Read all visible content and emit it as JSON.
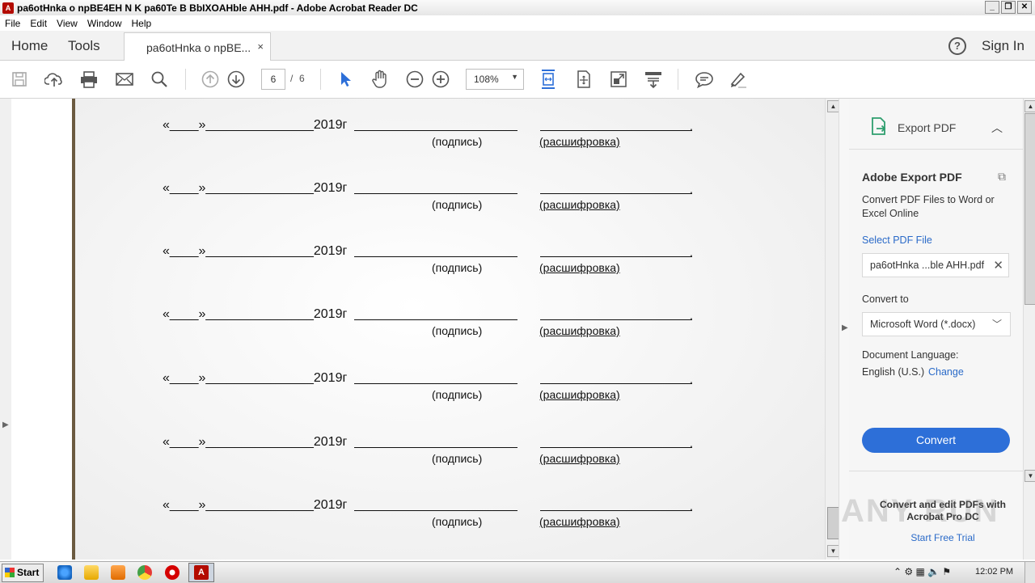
{
  "window": {
    "title": "pa6otHnka o npBE4EH N K pa60Te B BbIXOAHble AHH.pdf - Adobe Acrobat Reader DC",
    "icon_letter": "A",
    "controls": [
      "_",
      "❐",
      "✕"
    ]
  },
  "menu": [
    "File",
    "Edit",
    "View",
    "Window",
    "Help"
  ],
  "tabs": {
    "home": "Home",
    "tools": "Tools",
    "document": "pa6otHnka o npBE...",
    "close": "×",
    "help": "?",
    "sign_in": "Sign In"
  },
  "toolbar": {
    "page_current": "6",
    "page_sep": "/",
    "page_total": "6",
    "zoom": "108%",
    "icons": [
      "save-icon",
      "upload-cloud-icon",
      "print-icon",
      "email-icon",
      "search-icon",
      "page-up-icon",
      "page-down-icon",
      "select-arrow-icon",
      "hand-icon",
      "zoom-out-icon",
      "zoom-in-icon",
      "fit-width-icon",
      "scroll-mode-icon",
      "full-screen-icon",
      "read-mode-icon",
      "comment-icon",
      "highlight-pen-icon"
    ]
  },
  "document": {
    "rows": [
      {
        "date": "«____»_______________2019г",
        "sign": "(подпись)",
        "name": "(расшифровка)",
        "dot": "."
      },
      {
        "date": "«____»_______________2019г",
        "sign": "(подпись)",
        "name": "(расшифровка)",
        "dot": "."
      },
      {
        "date": "«____»_______________2019г",
        "sign": "(подпись)",
        "name": "(расшифровка)",
        "dot": "."
      },
      {
        "date": "«____»_______________2019г",
        "sign": "(подпись)",
        "name": "(расшифровка)",
        "dot": "."
      },
      {
        "date": "«____»_______________2019г",
        "sign": "(подпись)",
        "name": "(расшифровка)",
        "dot": "."
      },
      {
        "date": "«____»_______________2019г",
        "sign": "(подпись)",
        "name": "(расшифровка)",
        "dot": "."
      },
      {
        "date": "«____»_______________2019г",
        "sign": "(подпись)",
        "name": "(расшифровка)",
        "dot": "."
      }
    ]
  },
  "export_panel": {
    "header": "Export PDF",
    "title": "Adobe Export PDF",
    "desc": "Convert PDF Files to Word or Excel Online",
    "select_label": "Select PDF File",
    "file_name": "pa6otHnka ...ble AHH.pdf",
    "convert_to_label": "Convert to",
    "format": "Microsoft Word (*.docx)",
    "lang_label": "Document Language:",
    "lang_value": "English (U.S.)",
    "change": "Change",
    "convert_button": "Convert",
    "promo": "Convert and edit PDFs with Acrobat Pro DC",
    "trial": "Start Free Trial"
  },
  "watermark": "ANY RUN",
  "taskbar": {
    "start": "Start",
    "clock": "12:02 PM"
  },
  "colors": {
    "accent": "#2d6fd8",
    "link": "#2a6ac8",
    "acrobat_red": "#b30b00"
  }
}
